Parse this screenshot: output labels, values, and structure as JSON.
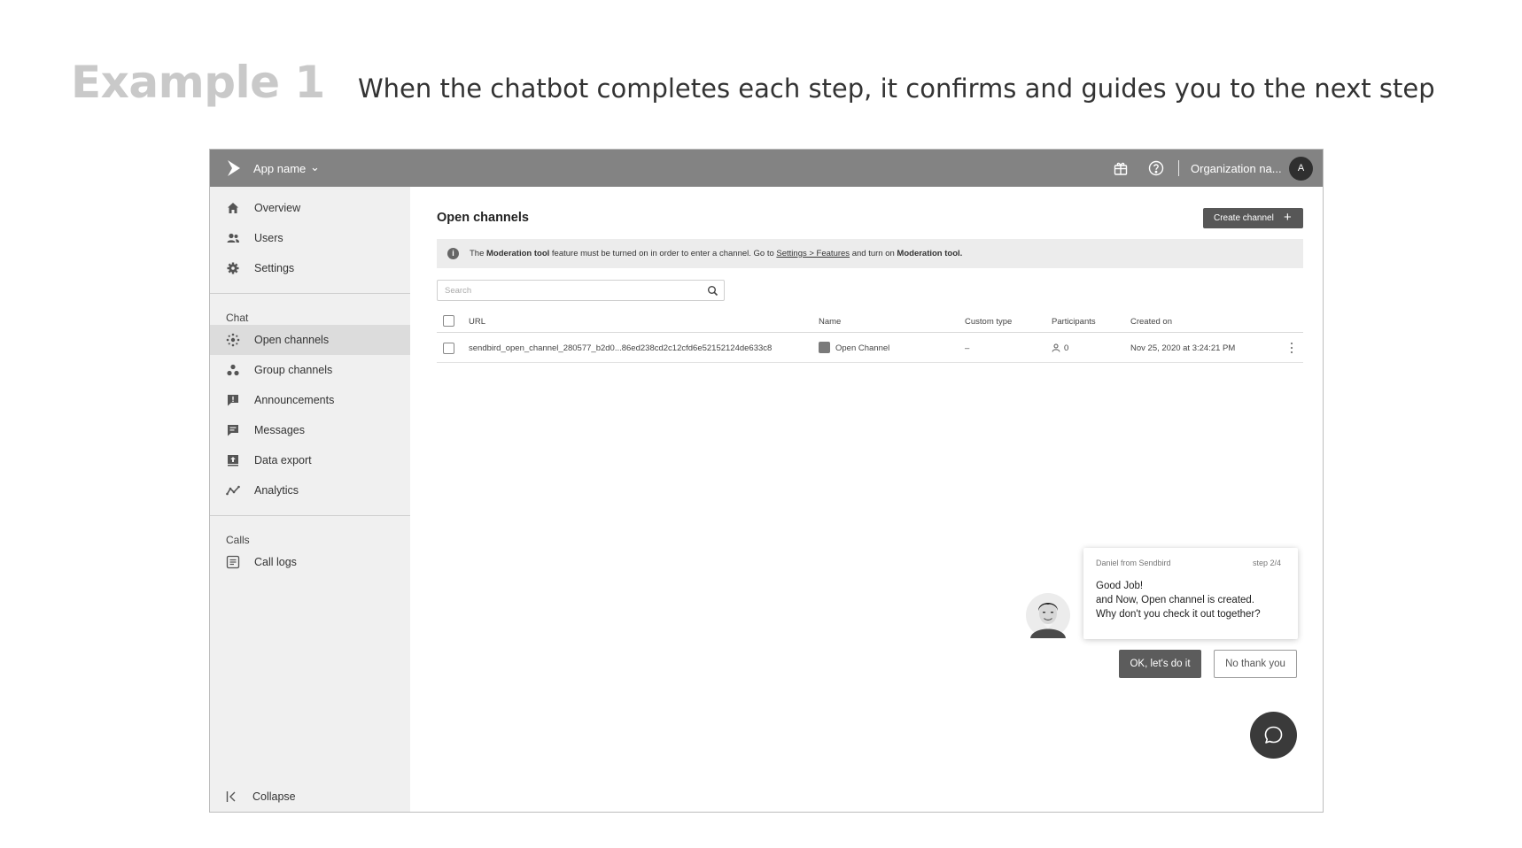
{
  "slide": {
    "title": "Example 1",
    "caption": "When the chatbot completes each step, it confirms and guides you to the next step"
  },
  "topbar": {
    "app_name": "App name",
    "org_name": "Organization na...",
    "avatar_initial": "A"
  },
  "sidebar": {
    "items": [
      {
        "label": "Overview",
        "icon": "home-icon"
      },
      {
        "label": "Users",
        "icon": "users-icon"
      },
      {
        "label": "Settings",
        "icon": "gear-icon"
      }
    ],
    "chat_section": "Chat",
    "chat_items": [
      {
        "label": "Open channels",
        "icon": "open-channels-icon",
        "active": true
      },
      {
        "label": "Group channels",
        "icon": "group-channels-icon"
      },
      {
        "label": "Announcements",
        "icon": "announcement-icon"
      },
      {
        "label": "Messages",
        "icon": "message-icon"
      },
      {
        "label": "Data export",
        "icon": "export-icon"
      },
      {
        "label": "Analytics",
        "icon": "analytics-icon"
      }
    ],
    "calls_section": "Calls",
    "calls_items": [
      {
        "label": "Call logs",
        "icon": "call-logs-icon"
      }
    ],
    "collapse_label": "Collapse"
  },
  "main": {
    "title": "Open channels",
    "create_button": "Create channel",
    "notice": {
      "t1": "The ",
      "b1": "Moderation tool",
      "t2": " feature must be turned on in order to enter a channel. Go to ",
      "link": "Settings > Features",
      "t3": " and turn on ",
      "b2": "Moderation tool.",
      "t4": ""
    },
    "search_placeholder": "Search",
    "table": {
      "headers": {
        "url": "URL",
        "name": "Name",
        "custom_type": "Custom type",
        "participants": "Participants",
        "created_on": "Created on"
      },
      "rows": [
        {
          "url": "sendbird_open_channel_280577_b2d0...86ed238cd2c12cfd6e52152124de633c8",
          "name": "Open Channel",
          "custom_type": "–",
          "participants": "0",
          "created_on": "Nov 25, 2020 at 3:24:21 PM"
        }
      ]
    }
  },
  "chatbot": {
    "from": "Daniel from Sendbird",
    "step": "step 2/4",
    "line1": "Good Job!",
    "line2": "and Now, Open channel is created.",
    "line3": "Why don't you check it out together?",
    "ok_label": "OK, let's do it",
    "no_label": "No thank you"
  },
  "colors": {
    "topbar": "#838383",
    "sidebar": "#f0f0f0",
    "active_item": "#dcdcdc",
    "primary_button": "#575757",
    "chat_fab": "#3a3a3a"
  }
}
